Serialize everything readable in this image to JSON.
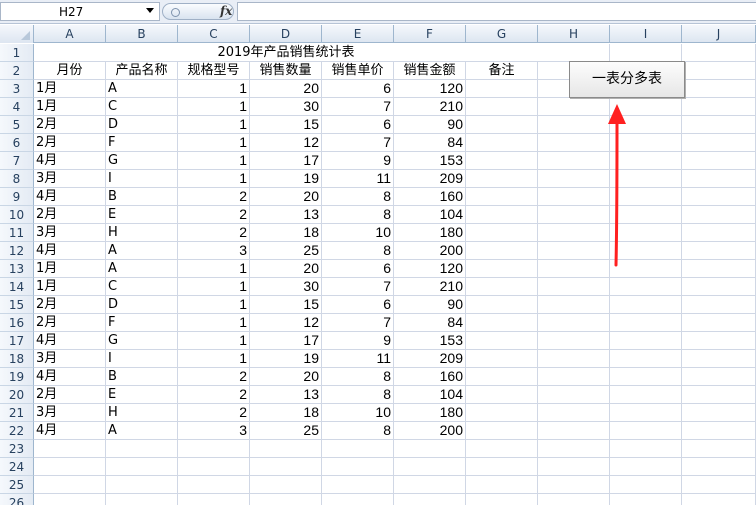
{
  "name_box": {
    "value": "H27"
  },
  "formula_bar": {
    "fx_label": "fx",
    "content": ""
  },
  "columns": [
    "A",
    "B",
    "C",
    "D",
    "E",
    "F",
    "G",
    "H",
    "I",
    "J"
  ],
  "sheet": {
    "title": "2019年产品销售统计表",
    "headers": [
      "月份",
      "产品名称",
      "规格型号",
      "销售数量",
      "销售单价",
      "销售金额",
      "备注"
    ],
    "rows": [
      [
        "1月",
        "A",
        "1",
        "20",
        "6",
        "120"
      ],
      [
        "1月",
        "C",
        "1",
        "30",
        "7",
        "210"
      ],
      [
        "2月",
        "D",
        "1",
        "15",
        "6",
        "90"
      ],
      [
        "2月",
        "F",
        "1",
        "12",
        "7",
        "84"
      ],
      [
        "4月",
        "G",
        "1",
        "17",
        "9",
        "153"
      ],
      [
        "3月",
        "I",
        "1",
        "19",
        "11",
        "209"
      ],
      [
        "4月",
        "B",
        "2",
        "20",
        "8",
        "160"
      ],
      [
        "2月",
        "E",
        "2",
        "13",
        "8",
        "104"
      ],
      [
        "3月",
        "H",
        "2",
        "18",
        "10",
        "180"
      ],
      [
        "4月",
        "A",
        "3",
        "25",
        "8",
        "200"
      ],
      [
        "1月",
        "A",
        "1",
        "20",
        "6",
        "120"
      ],
      [
        "1月",
        "C",
        "1",
        "30",
        "7",
        "210"
      ],
      [
        "2月",
        "D",
        "1",
        "15",
        "6",
        "90"
      ],
      [
        "2月",
        "F",
        "1",
        "12",
        "7",
        "84"
      ],
      [
        "4月",
        "G",
        "1",
        "17",
        "9",
        "153"
      ],
      [
        "3月",
        "I",
        "1",
        "19",
        "11",
        "209"
      ],
      [
        "4月",
        "B",
        "2",
        "20",
        "8",
        "160"
      ],
      [
        "2月",
        "E",
        "2",
        "13",
        "8",
        "104"
      ],
      [
        "3月",
        "H",
        "2",
        "18",
        "10",
        "180"
      ],
      [
        "4月",
        "A",
        "3",
        "25",
        "8",
        "200"
      ]
    ],
    "row_numbers": [
      "1",
      "2",
      "3",
      "4",
      "5",
      "6",
      "7",
      "8",
      "9",
      "10",
      "11",
      "12",
      "13",
      "14",
      "15",
      "16",
      "17",
      "18",
      "19",
      "20",
      "21",
      "22",
      "23",
      "24",
      "25",
      "26"
    ]
  },
  "button": {
    "label": "一表分多表"
  },
  "colors": {
    "arrow": "#ff2020",
    "header_text": "#27415f",
    "gridline": "#d0d7e5"
  }
}
